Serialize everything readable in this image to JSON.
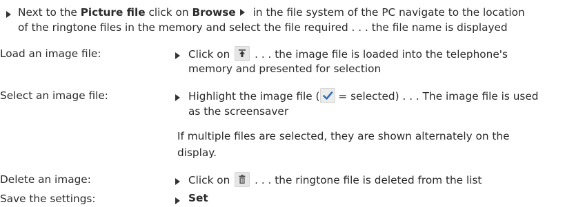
{
  "intro": {
    "line1_a": "Next to the ",
    "line1_b": "Picture file",
    "line1_c": " click on ",
    "line1_d": "Browse",
    "line1_e": " in the file system of the PC navigate to the location",
    "line2": "of the ringtone files in the memory and select the file required  . . . the file name is displayed"
  },
  "rows": [
    {
      "label": "Load an image file:",
      "pre": "Click on",
      "post": " . . . the image file is loaded into the telephone's",
      "line2": "memory and presented for selection",
      "icon": "upload-icon"
    },
    {
      "label": "Select an image file:",
      "pre": "Highlight the image file (",
      "post": " = selected)  . . . The image file is used",
      "line2": "as the screensaver",
      "icon": "checkmark-icon"
    },
    {
      "note1": "If multiple files are selected, they are shown alternately on the",
      "note2": "display."
    },
    {
      "label": "Delete an image:",
      "pre": "Click on",
      "post": " . . . the ringtone file is deleted from the list",
      "icon": "trash-icon"
    },
    {
      "label": "Save the settings:",
      "action": "Set"
    }
  ],
  "colors": {
    "text": "#2a2a2a",
    "icon_bg": "#e6e6e6",
    "check_blue": "#2f6fb5"
  }
}
